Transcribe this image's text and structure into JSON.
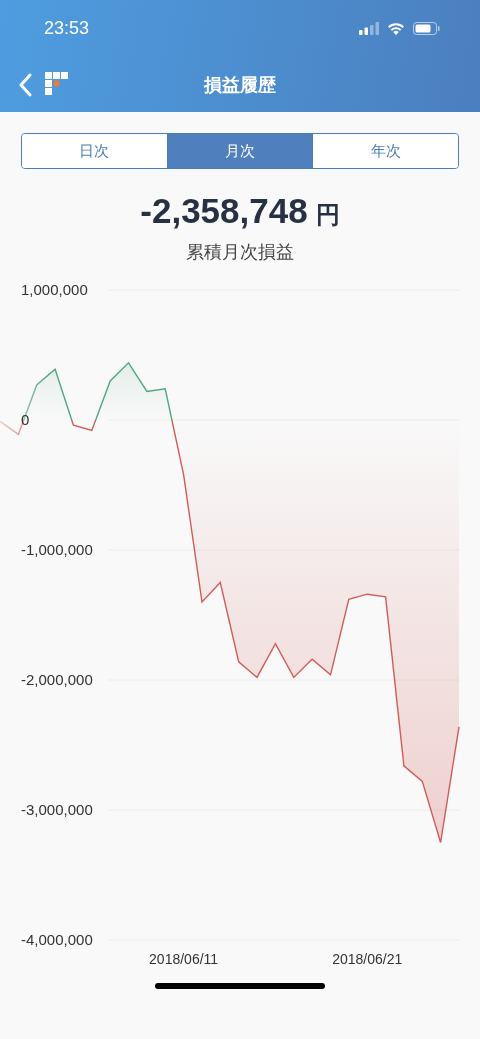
{
  "status_bar": {
    "time": "23:53"
  },
  "nav": {
    "title": "損益履歴"
  },
  "segments": [
    {
      "label": "日次",
      "selected": false
    },
    {
      "label": "月次",
      "selected": true
    },
    {
      "label": "年次",
      "selected": false
    }
  ],
  "summary": {
    "amount": "-2,358,748",
    "unit": "円",
    "label": "累積月次損益"
  },
  "chart_data": {
    "type": "area",
    "grid": true,
    "categories": [
      null,
      null,
      null,
      null,
      null,
      null,
      null,
      null,
      null,
      null,
      "2018/06/11",
      null,
      null,
      null,
      null,
      null,
      null,
      null,
      null,
      null,
      "2018/06/21",
      null,
      null,
      null,
      null,
      null
    ],
    "series": [
      {
        "color": "#cf5c57",
        "values": [
          -10000,
          -110000,
          270000,
          390000,
          -40000,
          -80000,
          300000,
          440000,
          220000,
          240000,
          -420000,
          -1400000,
          -1250000,
          -1860000,
          -1980000,
          -1720000,
          -1980000,
          -1840000,
          -1960000,
          -1380000,
          -1340000,
          -1360000,
          -2660000,
          -2780000,
          -3250000,
          -2360000
        ]
      }
    ],
    "ylim": [
      -4000000,
      1000000
    ],
    "yticks": [
      {
        "value": 1000000,
        "label": "1,000,000"
      },
      {
        "value": 0,
        "label": "0"
      },
      {
        "value": -1000000,
        "label": "-1,000,000"
      },
      {
        "value": -2000000,
        "label": "-2,000,000"
      },
      {
        "value": -3000000,
        "label": "-3,000,000"
      },
      {
        "value": -4000000,
        "label": "-4,000,000"
      }
    ]
  }
}
